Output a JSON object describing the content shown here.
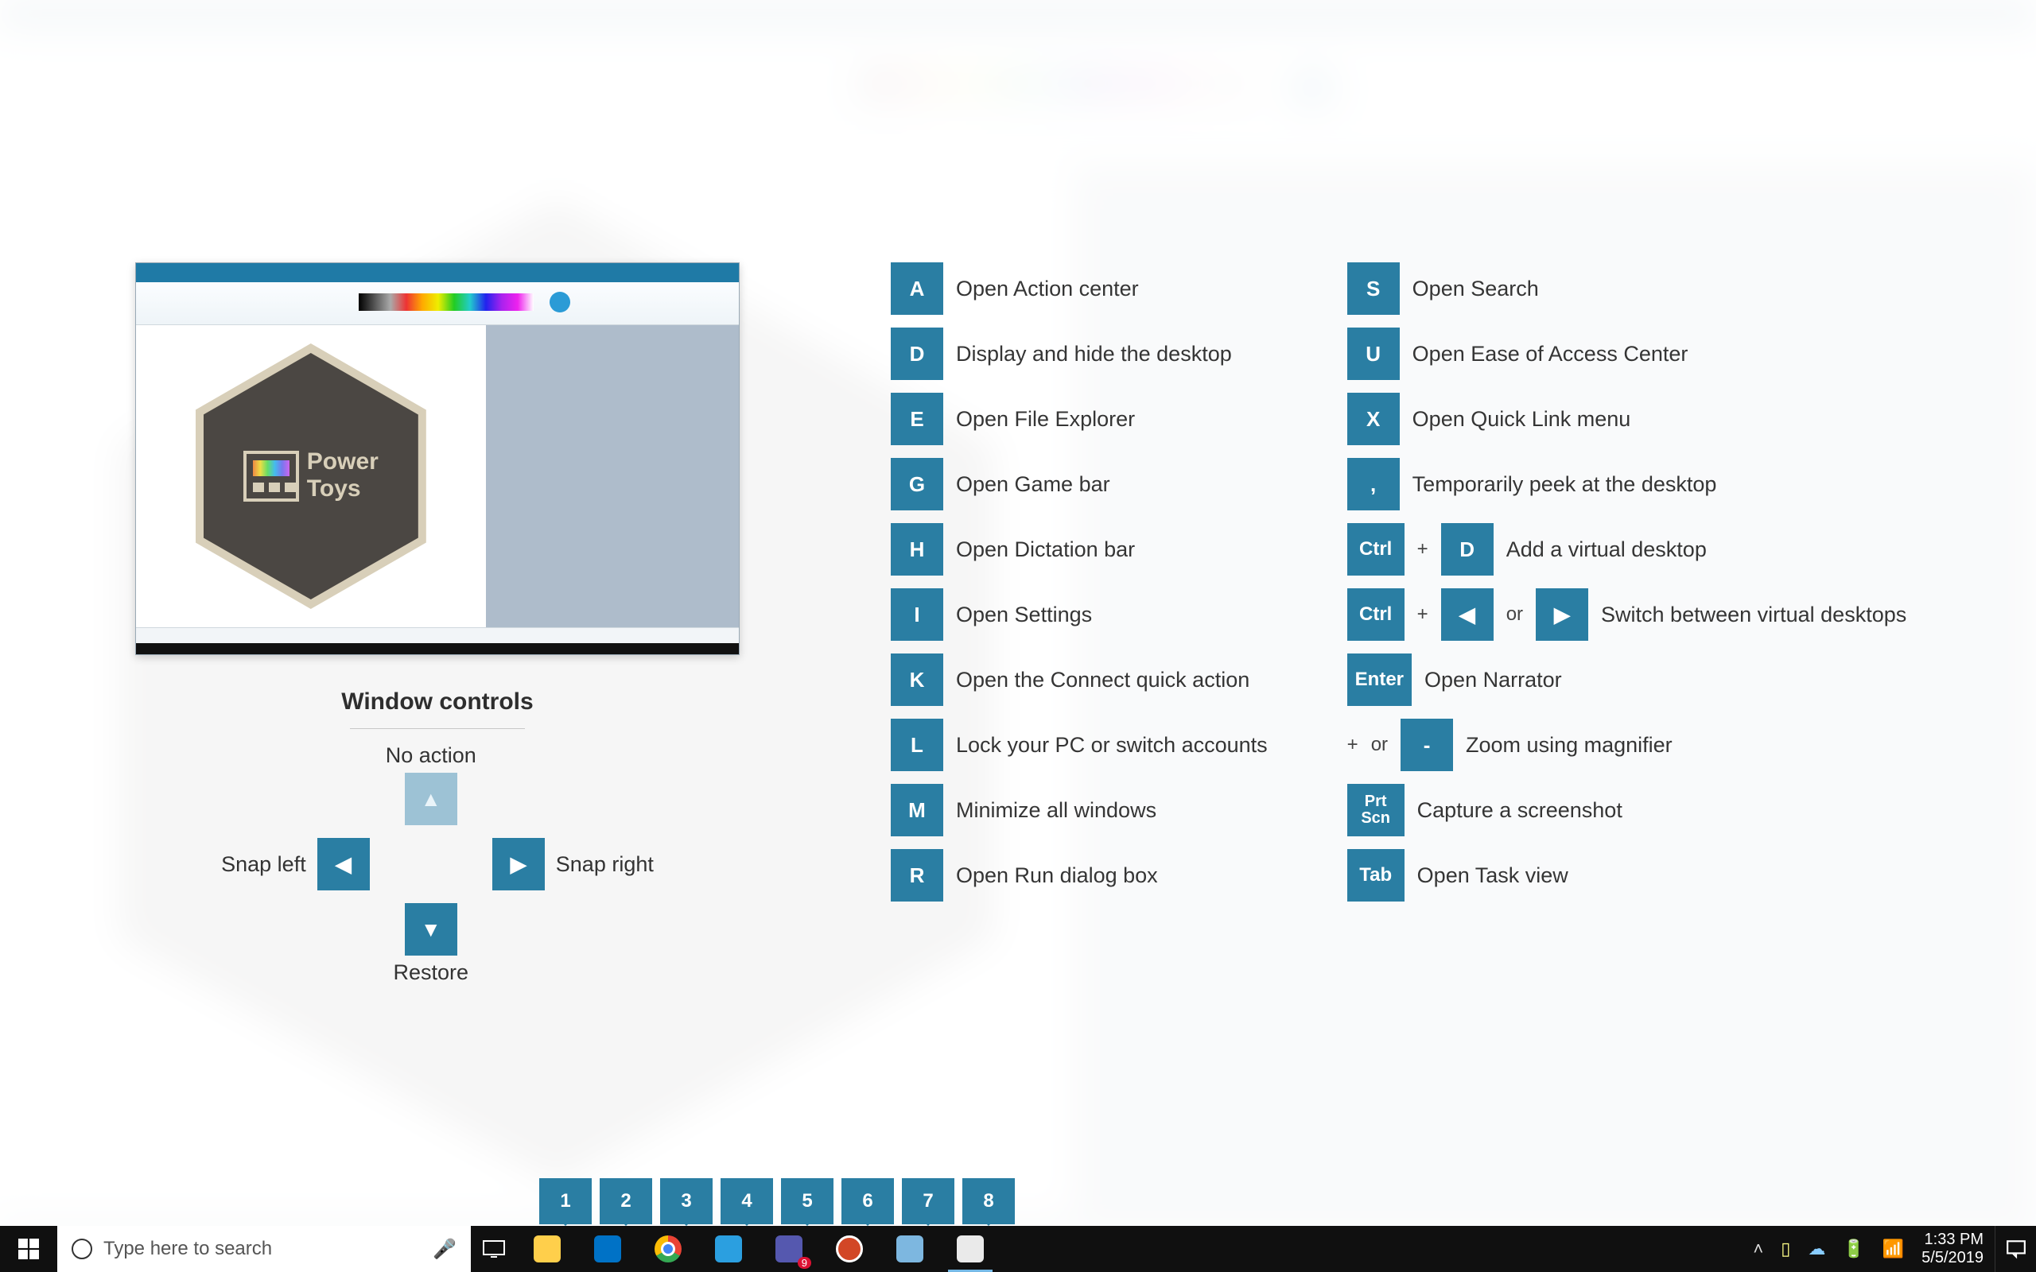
{
  "window_controls": {
    "title": "Window controls",
    "up": "No action",
    "down": "Restore",
    "left": "Snap left",
    "right": "Snap right"
  },
  "shortcuts_left": [
    {
      "key": "A",
      "desc": "Open Action center"
    },
    {
      "key": "D",
      "desc": "Display and hide the desktop"
    },
    {
      "key": "E",
      "desc": "Open File Explorer"
    },
    {
      "key": "G",
      "desc": "Open Game bar"
    },
    {
      "key": "H",
      "desc": "Open Dictation bar"
    },
    {
      "key": "I",
      "desc": "Open Settings"
    },
    {
      "key": "K",
      "desc": "Open the Connect quick action"
    },
    {
      "key": "L",
      "desc": "Lock your PC or switch accounts"
    },
    {
      "key": "M",
      "desc": "Minimize all windows"
    },
    {
      "key": "R",
      "desc": "Open Run dialog box"
    }
  ],
  "shortcuts_right": [
    {
      "keys": [
        "S"
      ],
      "desc": "Open Search"
    },
    {
      "keys": [
        "U"
      ],
      "desc": "Open Ease of Access Center"
    },
    {
      "keys": [
        "X"
      ],
      "desc": "Open Quick Link menu"
    },
    {
      "keys": [
        ","
      ],
      "desc": "Temporarily peek at the desktop"
    },
    {
      "keys": [
        "Ctrl",
        "+",
        "D"
      ],
      "desc": "Add a virtual desktop"
    },
    {
      "keys": [
        "Ctrl",
        "+",
        "◀",
        "or",
        "▶"
      ],
      "desc": "Switch between virtual desktops"
    },
    {
      "keys": [
        "Enter"
      ],
      "desc": "Open Narrator"
    },
    {
      "keys": [
        "+",
        "or",
        "-"
      ],
      "desc": "Zoom using magnifier"
    },
    {
      "keys": [
        "Prt Scn"
      ],
      "desc": "Capture a screenshot"
    },
    {
      "keys": [
        "Tab"
      ],
      "desc": "Open Task view"
    }
  ],
  "taskbar_numbers": [
    "1",
    "2",
    "3",
    "4",
    "5",
    "6",
    "7",
    "8"
  ],
  "taskbar": {
    "search_placeholder": "Type here to search",
    "apps": [
      {
        "name": "file-explorer",
        "color": "#ffcf4b"
      },
      {
        "name": "outlook",
        "color": "#0072c6"
      },
      {
        "name": "chrome",
        "color": "#ffffff"
      },
      {
        "name": "vscode",
        "color": "#2b9fe0"
      },
      {
        "name": "teams",
        "color": "#5558af",
        "badge": "9"
      },
      {
        "name": "powerpoint",
        "color": "#d24726"
      },
      {
        "name": "notepad",
        "color": "#7db7e0"
      },
      {
        "name": "paint",
        "color": "#eaeaea",
        "active": true
      }
    ],
    "time": "1:33 PM",
    "date": "5/5/2019"
  },
  "thumb": {
    "logo_line1": "Power",
    "logo_line2": "Toys"
  }
}
